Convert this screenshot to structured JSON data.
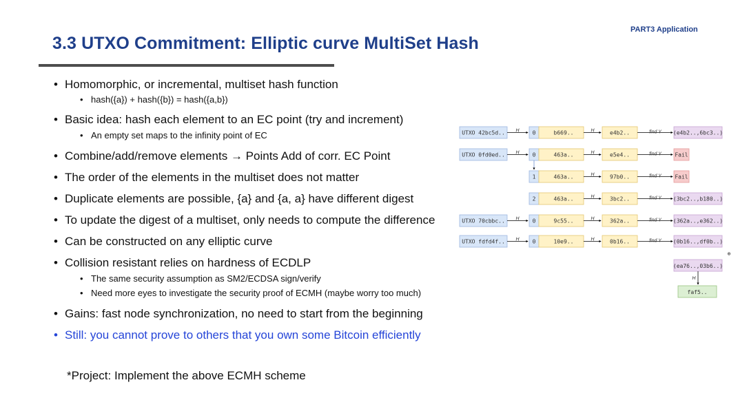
{
  "header": {
    "part": "PART3 Application",
    "title": "3.3  UTXO Commitment: Elliptic curve MultiSet Hash"
  },
  "bullets": [
    {
      "text": "Homomorphic, or incremental, multiset hash function",
      "children": [
        "hash({a}) + hash({b}) = hash({a,b})"
      ]
    },
    {
      "text": "Basic idea: hash each element to an EC point (try and increment)",
      "children": [
        "An empty set maps to the infinity point of EC"
      ]
    },
    {
      "text": "Combine/add/remove elements → Points Add of corr. EC Point"
    },
    {
      "text": "The order of the elements in the multiset does not matter"
    },
    {
      "text": "Duplicate elements are possible, {a} and {a, a} have different digest"
    },
    {
      "text": "To update the digest of a multiset, only needs to compute the difference"
    },
    {
      "text": "Can be constructed on any elliptic curve"
    },
    {
      "text": "Collision resistant relies on hardness of  ECDLP",
      "children": [
        "The same security assumption as SM2/ECDSA sign/verify",
        "Need more eyes to investigate the security proof of ECMH (maybe worry too much)"
      ]
    },
    {
      "text": "Gains: fast node synchronization, no need to start from the beginning"
    },
    {
      "text": "Still: you cannot prove to others that you own some Bitcoin efficiently",
      "color": "#2545d8"
    }
  ],
  "project": "*Project: Implement the above ECMH scheme",
  "diagram": {
    "colors": {
      "utxo_fill": "#d8e6f8",
      "utxo_stroke": "#9db6de",
      "index_fill": "#d8e6f8",
      "index_stroke": "#9db6de",
      "node_fill": "#fff2c7",
      "node_stroke": "#e5c772",
      "result_fill": "#ead9f0",
      "result_stroke": "#c6a3d3",
      "fail_fill": "#f7cccc",
      "fail_stroke": "#e49b9b",
      "final_fill": "#dcefd3",
      "final_stroke": "#99c481"
    },
    "h_label": "H",
    "find_label": "find Y",
    "rows": [
      {
        "utxo": "UTXO 42bc5d..",
        "index": "0",
        "hash1": "b669..",
        "hash2": "e4b2..",
        "result": "(e4b2..,6bc3..)",
        "result_type": "point"
      },
      {
        "utxo": "UTXO 0fd0ed..",
        "index": "0",
        "hash1": "463a..",
        "hash2": "e5e4..",
        "result": "Fail",
        "result_type": "fail"
      },
      {
        "utxo": "",
        "index": "1",
        "hash1": "463a..",
        "hash2": "97b0..",
        "result": "Fail",
        "result_type": "fail"
      },
      {
        "utxo": "",
        "index": "2",
        "hash1": "463a..",
        "hash2": "3bc2..",
        "result": "(3bc2..,b180..)",
        "result_type": "point"
      },
      {
        "utxo": "UTXO 70cbbc..",
        "index": "0",
        "hash1": "9c55..",
        "hash2": "362a..",
        "result": "(362a..,e362..)",
        "result_type": "point"
      },
      {
        "utxo": "UTXO fdfd4f..",
        "index": "0",
        "hash1": "10e9..",
        "hash2": "0b16..",
        "result": "(0b16..,df0b..)",
        "result_type": "point"
      }
    ],
    "sum_symbol": "⊕",
    "sum": "(ea76..,03b6..)",
    "final": "faf5.."
  }
}
